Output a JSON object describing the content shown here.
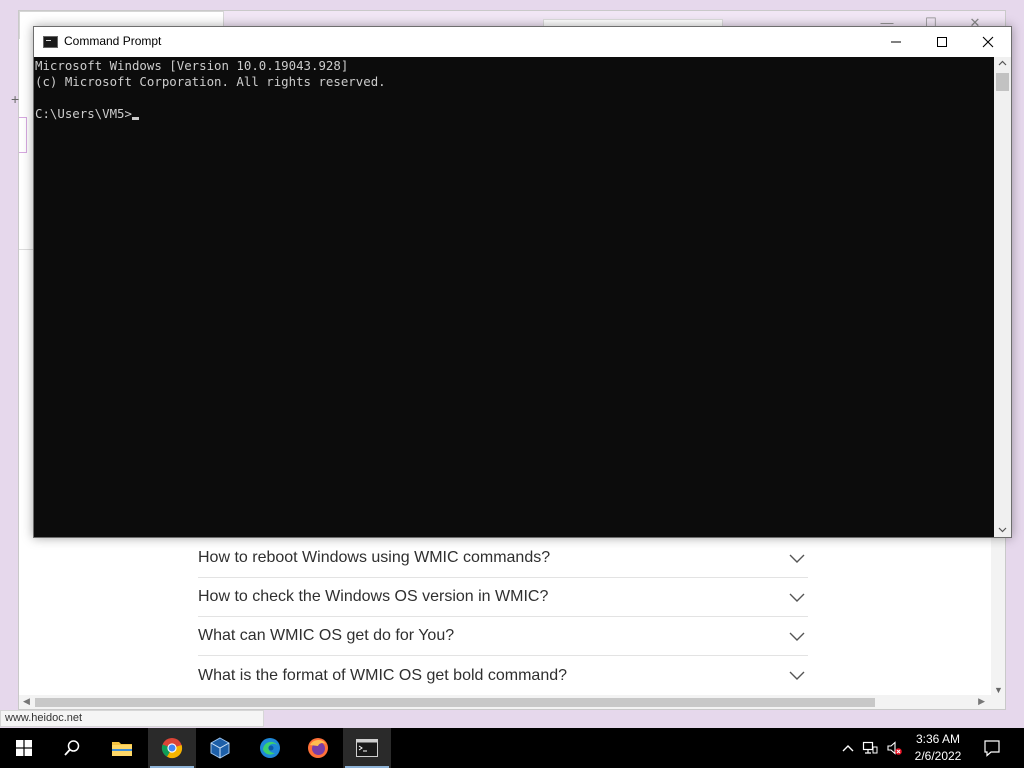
{
  "browser": {
    "status_url": "www.heidoc.net",
    "faq": [
      {
        "question": "How to reboot Windows using WMIC commands?"
      },
      {
        "question": "How to check the Windows OS version in WMIC?"
      },
      {
        "question": "What can WMIC OS get do for You?"
      },
      {
        "question": "What is the format of WMIC OS get bold command?"
      }
    ]
  },
  "cmd": {
    "title": "Command Prompt",
    "lines": [
      "Microsoft Windows [Version 10.0.19043.928]",
      "(c) Microsoft Corporation. All rights reserved.",
      "",
      "C:\\Users\\VM5>"
    ],
    "icons": {
      "minimize": "minimize-icon",
      "maximize": "maximize-icon",
      "close": "close-icon"
    }
  },
  "taskbar": {
    "apps": [
      {
        "name": "start",
        "icon": "windows-logo-icon"
      },
      {
        "name": "search",
        "icon": "search-icon"
      },
      {
        "name": "file-explorer",
        "icon": "folder-icon"
      },
      {
        "name": "chrome",
        "icon": "chrome-icon",
        "active": true
      },
      {
        "name": "virtualbox",
        "icon": "virtualbox-icon"
      },
      {
        "name": "edge",
        "icon": "edge-icon"
      },
      {
        "name": "firefox",
        "icon": "firefox-icon"
      },
      {
        "name": "command-prompt",
        "icon": "cmd-icon",
        "active": true
      }
    ],
    "clock": {
      "time": "3:36 AM",
      "date": "2/6/2022"
    }
  },
  "colors": {
    "console_bg": "#0c0c0c",
    "console_fg": "#cccccc",
    "taskbar_bg": "#000000",
    "desktop_bg": "#e6d8ec"
  }
}
